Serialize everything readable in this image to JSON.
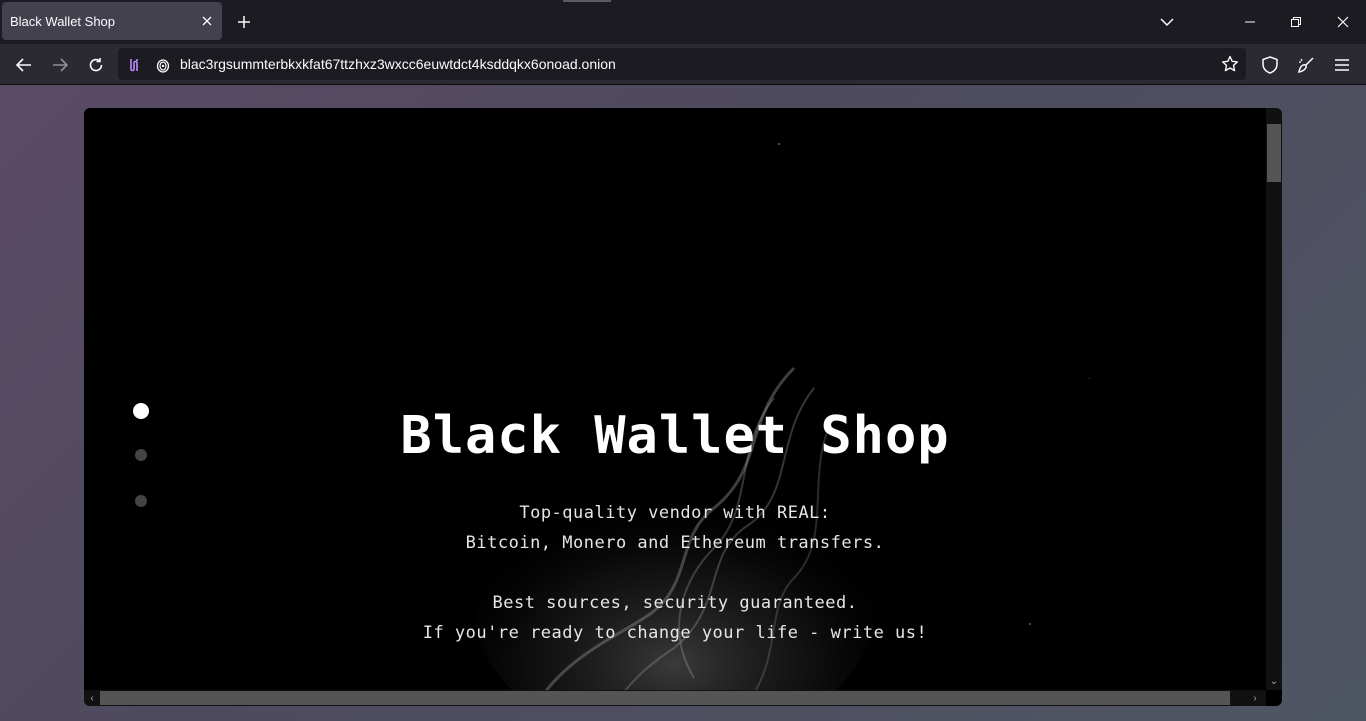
{
  "browser": {
    "tab": {
      "title": "Black Wallet Shop"
    },
    "url": "blac3rgsummterbkxkfat67ttzhxz3wxcc6euwtdct4ksddqkx6onoad.onion"
  },
  "page": {
    "title": "Black Wallet Shop",
    "lines": [
      "Top-quality vendor with REAL:",
      "Bitcoin, Monero and Ethereum transfers.",
      "Best sources, security guaranteed.",
      "If you're ready to change your life - write us!"
    ],
    "slide_dots": {
      "active": 1,
      "count": 3
    }
  },
  "colors": {
    "browser_bg": "#1c1b22",
    "toolbar_bg": "#2b2a33",
    "page_bg": "#000000",
    "text": "#ffffff"
  }
}
